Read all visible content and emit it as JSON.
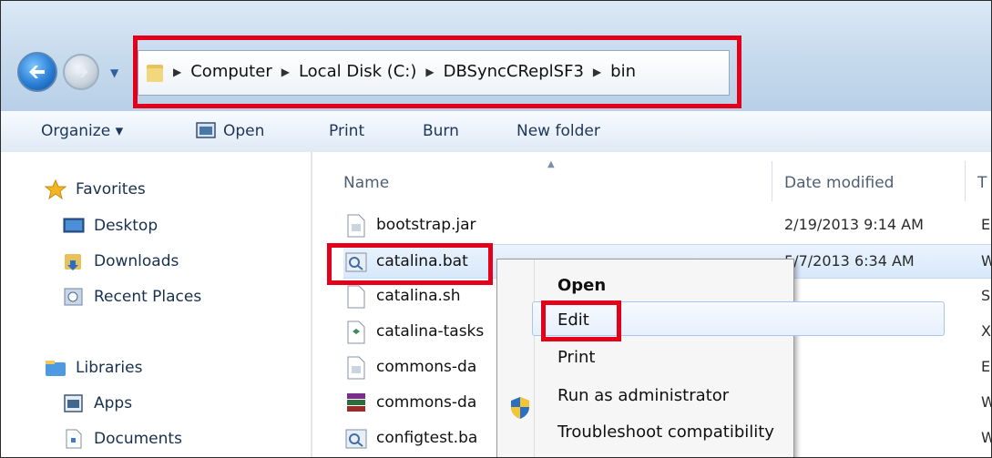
{
  "address_bar": {
    "breadcrumbs": [
      "Computer",
      "Local Disk (C:)",
      "DBSyncCReplSF3",
      "bin"
    ]
  },
  "toolbar": {
    "organize_label": "Organize ▾",
    "open_label": "Open",
    "print_label": "Print",
    "burn_label": "Burn",
    "new_folder_label": "New folder"
  },
  "sidebar": {
    "favorites_label": "Favorites",
    "favorites": [
      "Desktop",
      "Downloads",
      "Recent Places"
    ],
    "libraries_label": "Libraries",
    "libraries": [
      "Apps",
      "Documents"
    ]
  },
  "file_list": {
    "columns": [
      "Name",
      "Date modified"
    ],
    "type_col_partial": "T",
    "rows": [
      {
        "name": "bootstrap.jar",
        "date": "2/19/2013 9:14 AM",
        "type": "E",
        "icon": "jar-file-icon"
      },
      {
        "name": "catalina.bat",
        "date": "5/7/2013 6:34 AM",
        "type": "W",
        "icon": "bat-file-icon"
      },
      {
        "name": "catalina.sh",
        "date": "",
        "type": "S",
        "icon": "text-file-icon"
      },
      {
        "name": "catalina-tasks",
        "date": "",
        "type": "X",
        "icon": "xml-file-icon"
      },
      {
        "name": "commons-da",
        "date": "",
        "type": "E",
        "icon": "jar-file-icon"
      },
      {
        "name": "commons-da",
        "date": "",
        "type": "W",
        "icon": "archive-file-icon"
      },
      {
        "name": "configtest.ba",
        "date": "",
        "type": "W",
        "icon": "bat-file-icon"
      }
    ]
  },
  "context_menu": {
    "items": [
      "Open",
      "Edit",
      "Print",
      "Run as administrator",
      "Troubleshoot compatibility"
    ]
  },
  "colors": {
    "highlight_red": "#e2001a",
    "selection_blue": "#d8e8fb"
  }
}
